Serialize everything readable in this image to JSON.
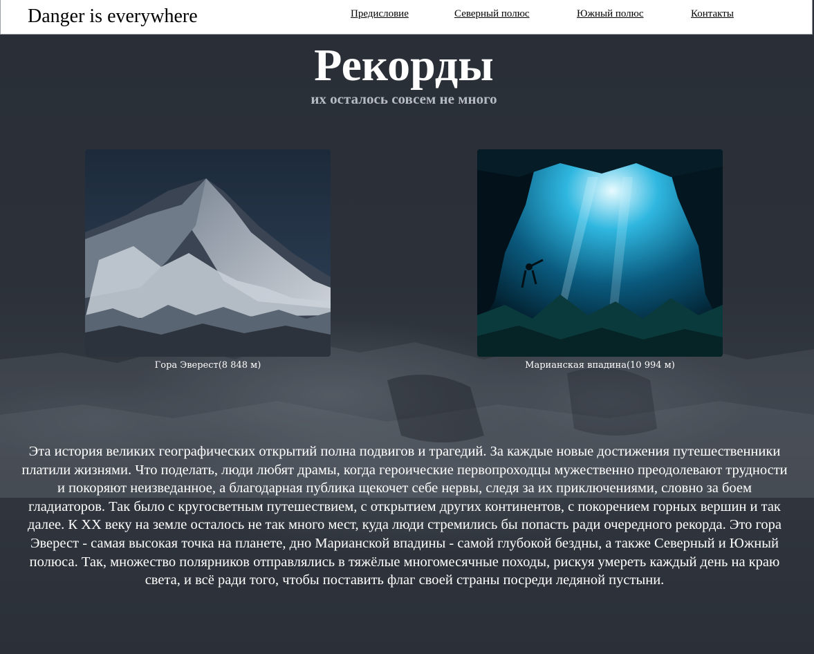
{
  "header": {
    "brand": "Danger is everywhere",
    "nav": [
      {
        "label": "Предисловие"
      },
      {
        "label": "Северный полюс"
      },
      {
        "label": "Южный полюс"
      },
      {
        "label": "Контакты"
      }
    ]
  },
  "hero": {
    "title": "Рекорды",
    "subtitle": "их осталось совсем не много"
  },
  "figures": [
    {
      "caption": "Гора Эверест(8 848 м)",
      "icon": "mountain-photo"
    },
    {
      "caption": "Марианская впадина(10 994 м)",
      "icon": "underwater-cave-photo"
    }
  ],
  "story": {
    "text": "Эта история великих географических открытий полна подвигов и трагедий. За каждые новые достижения путешественники платили жизнями. Что поделать, люди любят драмы, когда героические первопроходцы мужественно преодолевают трудности и покоряют неизведанное, а благодарная публика щекочет себе нервы, следя за их приключениями, словно за боем гладиаторов. Так было с кругосветным путешествием, с открытием других континентов, с покорением горных вершин и так далее. К XX веку на земле осталось не так много мест, куда люди стремились бы попасть ради очередного рекорда. Это гора Эверест - самая высокая точка на планете, дно Марианской впадины - самой глубокой бездны, а также Северный и Южный полюса. Так, множество полярников отправлялись в тяжёлые многомесячные походы, рискуя умереть каждый день на краю света, и всё ради того, чтобы поставить флаг своей страны посреди ледяной пустыни."
  },
  "colors": {
    "background": "#2b3038",
    "header_bg": "#ffffff",
    "text": "#ffffff",
    "subtitle": "#b7bcc2"
  }
}
